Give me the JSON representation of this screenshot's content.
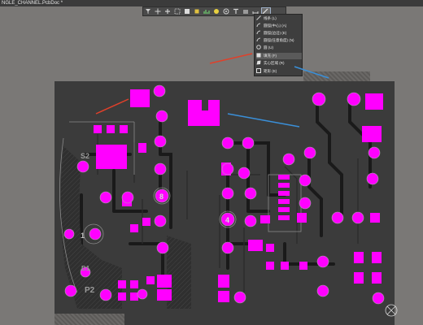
{
  "window": {
    "title": "NGLE_CHANNEL.PcbDoc *"
  },
  "toolbar": {
    "buttons": [
      {
        "icon": "filter-icon"
      },
      {
        "icon": "move-icon"
      },
      {
        "icon": "add-icon"
      },
      {
        "icon": "select-rect-icon"
      },
      {
        "icon": "align-icon"
      },
      {
        "icon": "component-icon"
      },
      {
        "icon": "bar-chart-icon"
      },
      {
        "icon": "pad-icon"
      },
      {
        "icon": "via-icon"
      },
      {
        "icon": "text-icon"
      },
      {
        "icon": "region-icon"
      },
      {
        "icon": "dimension-icon"
      },
      {
        "icon": "line-icon"
      }
    ]
  },
  "menu": {
    "items": [
      {
        "label": "线条 (L)",
        "icon": "line-icon"
      },
      {
        "label": "圆弧(中心) (A)",
        "icon": "arc-center-icon"
      },
      {
        "label": "圆弧(边沿) (E)",
        "icon": "arc-edge-icon"
      },
      {
        "label": "圆弧(任意角度) (N)",
        "icon": "arc-any-icon"
      },
      {
        "label": "圆 (U)",
        "icon": "circle-icon"
      },
      {
        "label": "填充 (F)",
        "icon": "fill-icon"
      },
      {
        "label": "实心区域 (R)",
        "icon": "solid-region-icon"
      },
      {
        "label": "矩形 (E)",
        "icon": "rectangle-icon"
      }
    ]
  },
  "board": {
    "silk_labels": [
      "8",
      "4",
      "1",
      "P2",
      "D1",
      "S2"
    ]
  },
  "colors": {
    "pad": "#ff00ff",
    "board": "#3b3b3b",
    "trace": "#1f1f1f",
    "silk": "#bdbdbd",
    "arrow_red": "#e0402a",
    "arrow_blue": "#3a8fd8"
  }
}
